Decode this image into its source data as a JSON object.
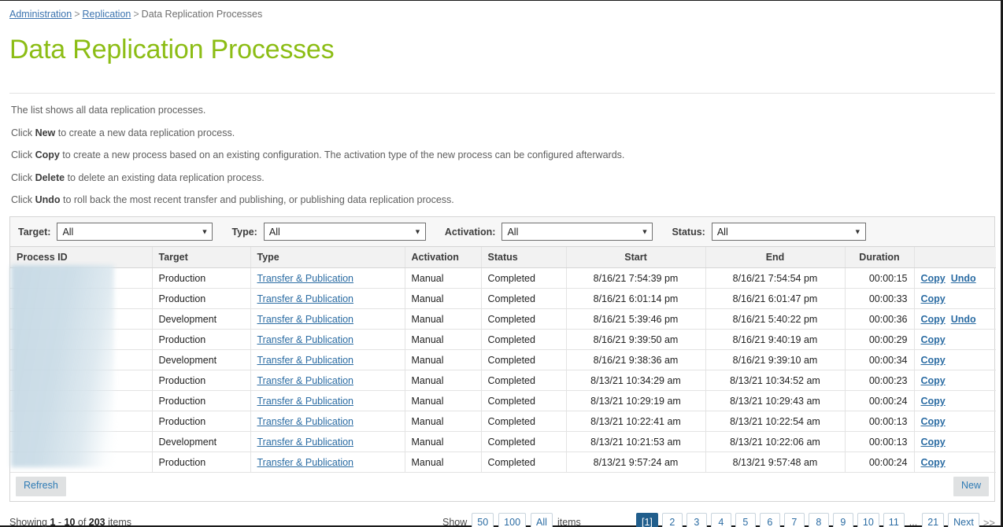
{
  "breadcrumb": {
    "items": [
      {
        "label": "Administration",
        "link": true
      },
      {
        "label": "Replication",
        "link": true
      },
      {
        "label": "Data Replication Processes",
        "link": false
      }
    ],
    "separator": ">"
  },
  "page": {
    "title": "Data Replication Processes",
    "title_color": "#8cbd15"
  },
  "intro": {
    "line1": "The list shows all data replication processes.",
    "line2_pre": "Click ",
    "line2_bold": "New",
    "line2_post": " to create a new data replication process.",
    "line3_pre": "Click ",
    "line3_bold": "Copy",
    "line3_post": " to create a new process based on an existing configuration. The activation type of the new process can be configured afterwards.",
    "line4_pre": "Click ",
    "line4_bold": "Delete",
    "line4_post": " to delete an existing data replication process.",
    "line5_pre": "Click ",
    "line5_bold": "Undo",
    "line5_post": " to roll back the most recent transfer and publishing, or publishing data replication process."
  },
  "filters": {
    "target": {
      "label": "Target:",
      "value": "All"
    },
    "type": {
      "label": "Type:",
      "value": "All"
    },
    "activation": {
      "label": "Activation:",
      "value": "All"
    },
    "status": {
      "label": "Status:",
      "value": "All"
    },
    "caret_icon": "chevron-down-icon"
  },
  "table": {
    "headers": {
      "process_id": "Process ID",
      "target": "Target",
      "type": "Type",
      "activation": "Activation",
      "status": "Status",
      "start": "Start",
      "end": "End",
      "duration": "Duration",
      "actions": ""
    },
    "rows": [
      {
        "process_id": "",
        "target": "Production",
        "type": "Transfer & Publication",
        "activation": "Manual",
        "status": "Completed",
        "start": "8/16/21 7:54:39 pm",
        "end": "8/16/21 7:54:54 pm",
        "duration": "00:00:15",
        "copy": "Copy",
        "undo": "Undo"
      },
      {
        "process_id": "",
        "target": "Production",
        "type": "Transfer & Publication",
        "activation": "Manual",
        "status": "Completed",
        "start": "8/16/21 6:01:14 pm",
        "end": "8/16/21 6:01:47 pm",
        "duration": "00:00:33",
        "copy": "Copy",
        "undo": ""
      },
      {
        "process_id": "",
        "target": "Development",
        "type": "Transfer & Publication",
        "activation": "Manual",
        "status": "Completed",
        "start": "8/16/21 5:39:46 pm",
        "end": "8/16/21 5:40:22 pm",
        "duration": "00:00:36",
        "copy": "Copy",
        "undo": "Undo"
      },
      {
        "process_id": "",
        "target": "Production",
        "type": "Transfer & Publication",
        "activation": "Manual",
        "status": "Completed",
        "start": "8/16/21 9:39:50 am",
        "end": "8/16/21 9:40:19 am",
        "duration": "00:00:29",
        "copy": "Copy",
        "undo": ""
      },
      {
        "process_id": "",
        "target": "Development",
        "type": "Transfer & Publication",
        "activation": "Manual",
        "status": "Completed",
        "start": "8/16/21 9:38:36 am",
        "end": "8/16/21 9:39:10 am",
        "duration": "00:00:34",
        "copy": "Copy",
        "undo": ""
      },
      {
        "process_id": "",
        "target": "Production",
        "type": "Transfer & Publication",
        "activation": "Manual",
        "status": "Completed",
        "start": "8/13/21 10:34:29 am",
        "end": "8/13/21 10:34:52 am",
        "duration": "00:00:23",
        "copy": "Copy",
        "undo": ""
      },
      {
        "process_id": "",
        "target": "Production",
        "type": "Transfer & Publication",
        "activation": "Manual",
        "status": "Completed",
        "start": "8/13/21 10:29:19 am",
        "end": "8/13/21 10:29:43 am",
        "duration": "00:00:24",
        "copy": "Copy",
        "undo": ""
      },
      {
        "process_id": "",
        "target": "Production",
        "type": "Transfer & Publication",
        "activation": "Manual",
        "status": "Completed",
        "start": "8/13/21 10:22:41 am",
        "end": "8/13/21 10:22:54 am",
        "duration": "00:00:13",
        "copy": "Copy",
        "undo": ""
      },
      {
        "process_id": "",
        "target": "Development",
        "type": "Transfer & Publication",
        "activation": "Manual",
        "status": "Completed",
        "start": "8/13/21 10:21:53 am",
        "end": "8/13/21 10:22:06 am",
        "duration": "00:00:13",
        "copy": "Copy",
        "undo": ""
      },
      {
        "process_id": "",
        "target": "Production",
        "type": "Transfer & Publication",
        "activation": "Manual",
        "status": "Completed",
        "start": "8/13/21 9:57:24 am",
        "end": "8/13/21 9:57:48 am",
        "duration": "00:00:24",
        "copy": "Copy",
        "undo": ""
      }
    ]
  },
  "buttons": {
    "refresh": "Refresh",
    "new": "New"
  },
  "footer": {
    "showing_pre": "Showing ",
    "showing_from": "1",
    "showing_dash": " - ",
    "showing_to": "10",
    "showing_of": " of ",
    "showing_total": "203",
    "showing_post": " items",
    "show_label": "Show",
    "page_sizes": [
      "50",
      "100",
      "All"
    ],
    "items_label": "items",
    "pages": [
      "[1]",
      "2",
      "3",
      "4",
      "5",
      "6",
      "7",
      "8",
      "9",
      "10",
      "11"
    ],
    "ellipsis": "...",
    "last_page": "21",
    "next": "Next",
    "next_double": ">>",
    "active_page_index": 0
  }
}
